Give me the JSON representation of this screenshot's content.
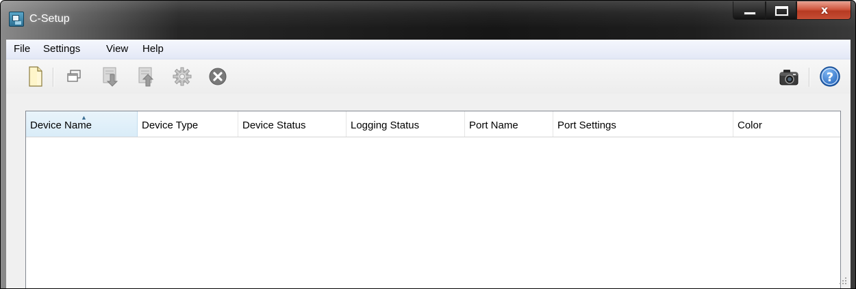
{
  "window": {
    "title": "C-Setup",
    "close_glyph": "x"
  },
  "menu": {
    "items": [
      "File",
      "Settings",
      "View",
      "Help"
    ]
  },
  "toolbar": {
    "icons": [
      "new-document-icon",
      "windows-icon",
      "download-icon",
      "upload-icon",
      "gear-icon",
      "close-circle-icon",
      "camera-icon",
      "help-icon"
    ]
  },
  "table": {
    "columns": [
      "Device Name",
      "Device Type",
      "Device Status",
      "Logging Status",
      "Port Name",
      "Port Settings",
      "Color"
    ],
    "sorted_column": "Device Name",
    "rows": []
  },
  "colors": {
    "accent": "#2f7fd6",
    "header_sorted": "#dcedf8"
  }
}
